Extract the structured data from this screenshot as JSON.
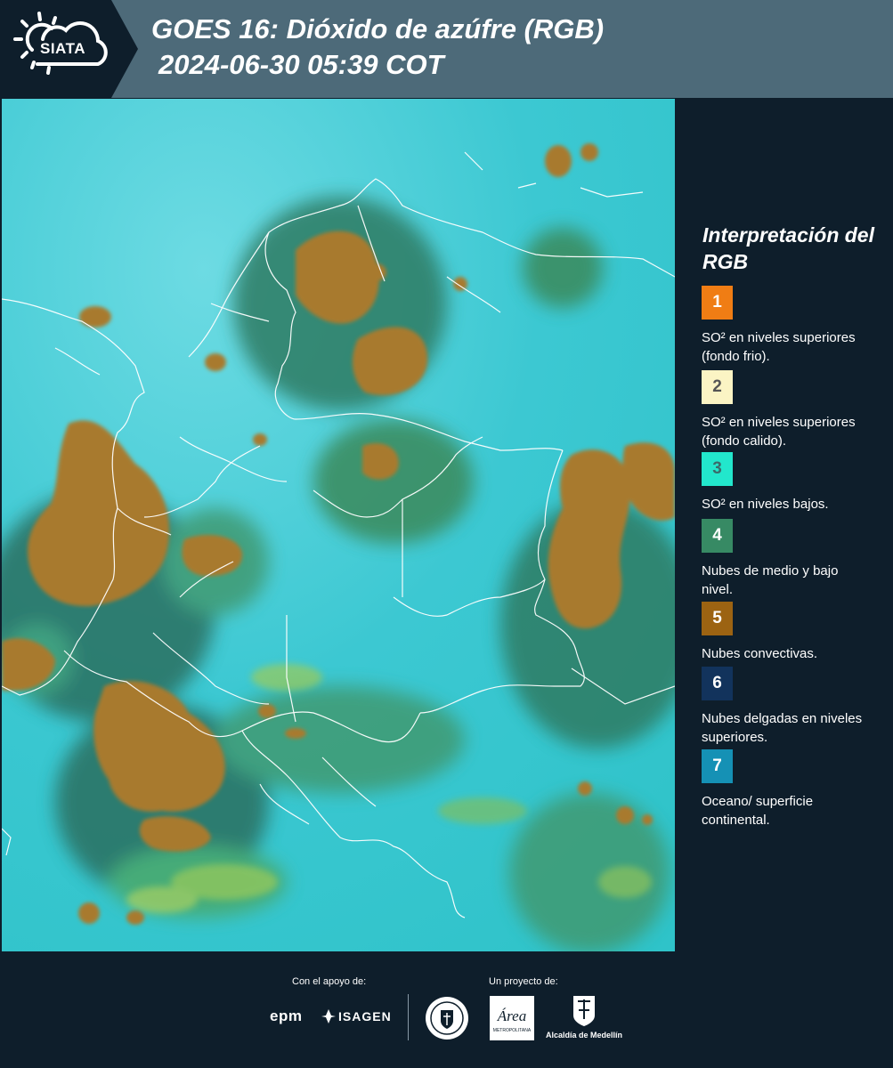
{
  "header": {
    "logo_text": "SIATA",
    "title_line1": "GOES 16: Dióxido de azúfre (RGB)",
    "title_line2": "2024-06-30 05:39 COT"
  },
  "legend": {
    "title": "Interpretación del RGB",
    "items": [
      {
        "number": "1",
        "color": "#f07d14",
        "text_color": "#ffffff",
        "description": "SO² en niveles superiores (fondo frio)."
      },
      {
        "number": "2",
        "color": "#fbf4c4",
        "text_color": "#555555",
        "description": "SO² en niveles superiores (fondo calido)."
      },
      {
        "number": "3",
        "color": "#22e7cc",
        "text_color": "#3a6b6a",
        "description": "SO² en niveles bajos."
      },
      {
        "number": "4",
        "color": "#378a64",
        "text_color": "#ffffff",
        "description": "Nubes de medio y bajo nivel."
      },
      {
        "number": "5",
        "color": "#9c6312",
        "text_color": "#ffffff",
        "description": "Nubes convectivas."
      },
      {
        "number": "6",
        "color": "#12335c",
        "text_color": "#ffffff",
        "description": "Nubes delgadas en niveles superiores."
      },
      {
        "number": "7",
        "color": "#1591b5",
        "text_color": "#ffffff",
        "description": "Oceano/ superficie continental."
      }
    ]
  },
  "footer": {
    "support_label": "Con el apoyo de:",
    "project_label": "Un proyecto de:",
    "sponsor1": "epm",
    "sponsor2": "ISAGEN",
    "area_logo_text": "Área",
    "area_logo_subtext": "METROPOLITANA",
    "alcaldia": "Alcaldía de Medellín"
  }
}
